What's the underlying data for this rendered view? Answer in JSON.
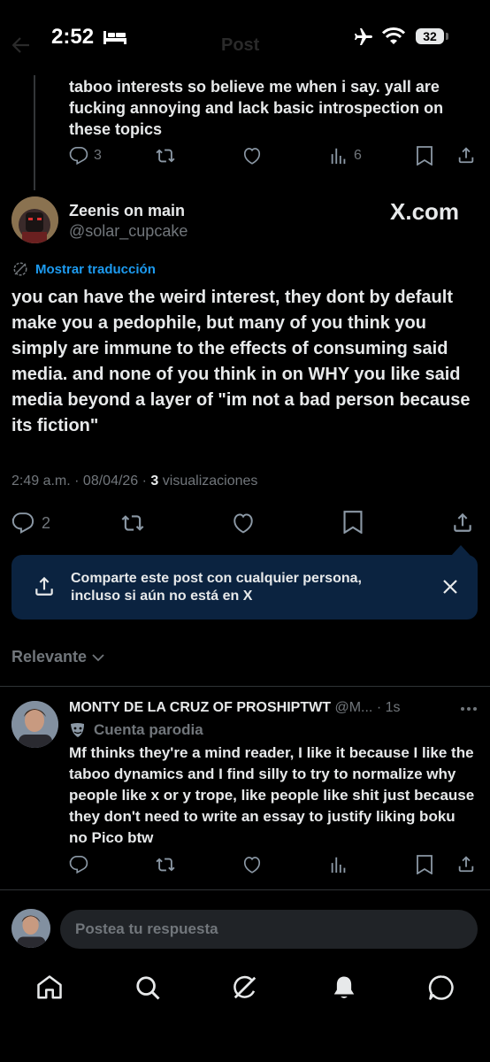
{
  "status_bar": {
    "time": "2:52",
    "battery": "32"
  },
  "header": {
    "title": "Post"
  },
  "parent_tweet": {
    "text": "taboo interests so believe me when i say. yall are fucking annoying and lack basic introspection on these topics",
    "replies": "3",
    "views": "6"
  },
  "main_tweet": {
    "display_name": "Zeenis on main",
    "handle": "@solar_cupcake",
    "watermark": "X.com",
    "translate_label": "Mostrar traducción",
    "text": "you can have the weird interest, they dont by default make you a pedophile, but many of you think you simply are immune to the effects of consuming said media. and none of you think in on WHY you like said media beyond a layer of \"im not a bad person because its fiction\"",
    "time": "2:49 a.m.",
    "date": "08/04/26",
    "views_count": "3",
    "views_label": "visualizaciones",
    "replies": "2"
  },
  "share_banner": {
    "text": "Comparte este post con cualquier persona, incluso si aún no está en X"
  },
  "sort": {
    "label": "Relevante"
  },
  "reply": {
    "display_name": "MONTY DE LA CRUZ OF PROSHIPTWT",
    "handle": "@M...",
    "time": "1s",
    "badge": "Cuenta parodia",
    "text": "Mf thinks they're a mind reader, I like it because I like the taboo dynamics and I find silly to try to normalize why people like x or y trope, like people like shit just because they don't need to write an essay to justify liking boku no Pico btw"
  },
  "compose": {
    "placeholder": "Postea tu respuesta"
  },
  "colors": {
    "accent": "#1d9bf0",
    "banner": "#0b2340",
    "gray": "#71767b"
  },
  "bottom_nav": [
    "home-icon",
    "search-icon",
    "grok-icon",
    "notifications-icon",
    "messages-icon"
  ]
}
